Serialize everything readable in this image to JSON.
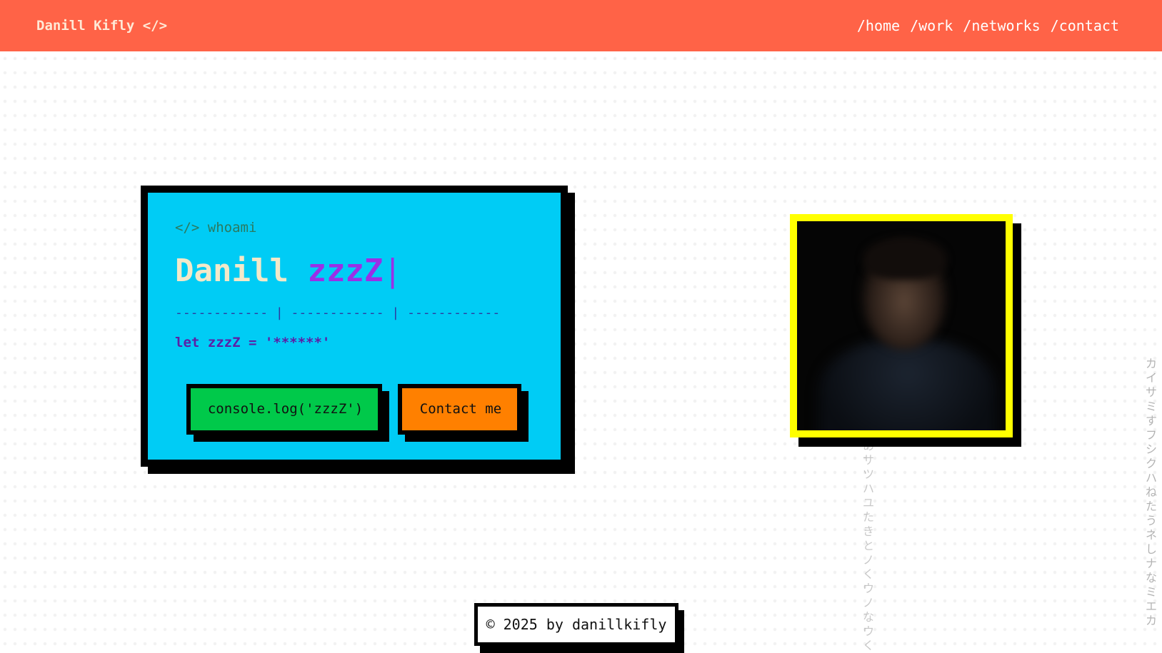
{
  "header": {
    "brand": "Danill Kifly </>",
    "nav": [
      "/home",
      "/work",
      "/networks",
      "/contact"
    ]
  },
  "hero": {
    "tag": "</> whoami",
    "name": "Danill",
    "typed": "zzzZ",
    "cursor": "|",
    "divider": "------------ | ------------ | ------------",
    "code_line": "let zzzZ = '******'",
    "primary_button": "console.log('zzzZ')",
    "secondary_button": "Contact me"
  },
  "background": {
    "column_1": "あサツハユたきとノくウノなウく",
    "column_2": "カイサミすフシクハねたうネしナなミエカ"
  },
  "footer": {
    "copyright": "© 2025 by danillkifly"
  },
  "colors": {
    "header": "#ff6347",
    "card": "#00ccf5",
    "avatar_border": "#ffff00",
    "button_green": "#00c94a",
    "button_orange": "#ff8000",
    "accent_purple": "#9b2fe6"
  }
}
